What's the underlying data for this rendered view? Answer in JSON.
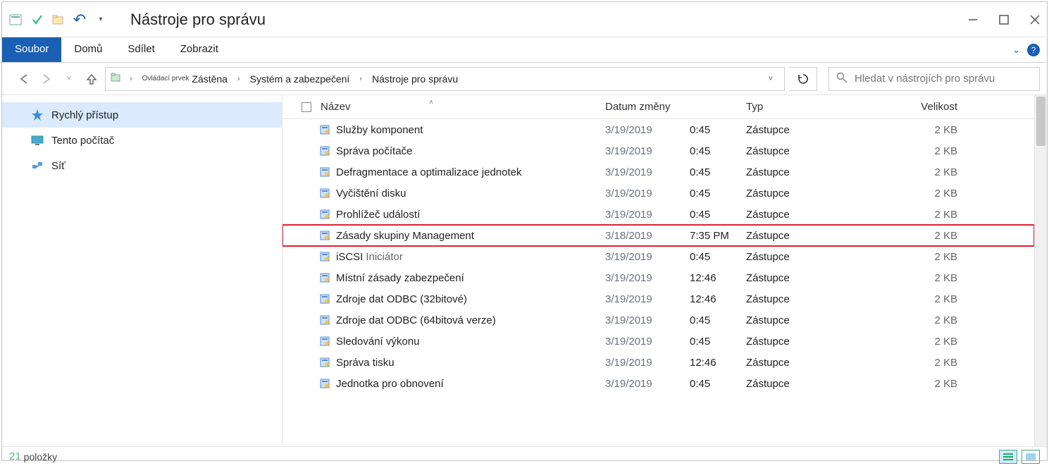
{
  "title": "Nástroje pro správu",
  "tabs": {
    "file": "Soubor",
    "home": "Domů",
    "share": "Sdílet",
    "view": "Zobrazit"
  },
  "breadcrumb": {
    "label_small": "Ovládací prvek",
    "items": [
      "Zástěna",
      "Systém a zabezpečení",
      "Nástroje pro správu"
    ]
  },
  "search": {
    "placeholder": "Hledat v nástrojích pro správu"
  },
  "sidebar": {
    "quick": "Rychlý přístup",
    "thispc": "Tento počítač",
    "network": "Síť"
  },
  "columns": {
    "name": "Název",
    "date": "Datum změny",
    "type": "Typ",
    "size": "Velikost"
  },
  "default_type": "Zástupce",
  "rows": [
    {
      "name": "Služby komponent",
      "date": "3/19/2019",
      "time": "0:45",
      "size": "2 KB"
    },
    {
      "name": "Správa počítače",
      "date": "3/19/2019",
      "time": "0:45",
      "size": "2 KB"
    },
    {
      "name": "Defragmentace a optimalizace jednotek",
      "date": "3/19/2019",
      "time": "0:45",
      "size": "2 KB"
    },
    {
      "name": "Vyčištění disku",
      "date": "3/19/2019",
      "time": "0:45",
      "size": "2 KB"
    },
    {
      "name": "Prohlížeč událostí",
      "date": "3/19/2019",
      "time": "0:45",
      "size": "2 KB"
    },
    {
      "name": "Zásady skupiny Management",
      "date": "3/18/2019",
      "time": "7:35 PM",
      "size": "2 KB",
      "highlight": true
    },
    {
      "name": "iSCSI",
      "sub": "Iniciátor",
      "date": "3/19/2019",
      "time": "0:45",
      "size": "2 KB"
    },
    {
      "name": "Místní zásady zabezpečení",
      "date": "3/19/2019",
      "time": "12:46",
      "size": "2 KB"
    },
    {
      "name": "Zdroje dat ODBC (32bitové)",
      "date": "3/19/2019",
      "time": "12:46",
      "size": "2 KB"
    },
    {
      "name": "Zdroje dat ODBC (64bitová verze)",
      "date": "3/19/2019",
      "time": "0:45",
      "size": "2 KB"
    },
    {
      "name": "Sledování výkonu",
      "date": "3/19/2019",
      "time": "0:45",
      "size": "2 KB"
    },
    {
      "name": "Správa tisku",
      "date": "3/19/2019",
      "time": "12:46",
      "size": "2 KB"
    },
    {
      "name": "Jednotka pro obnovení",
      "date": "3/19/2019",
      "time": "0:45",
      "size": "2 KB"
    }
  ],
  "status": {
    "count": "21",
    "label": "položky"
  }
}
